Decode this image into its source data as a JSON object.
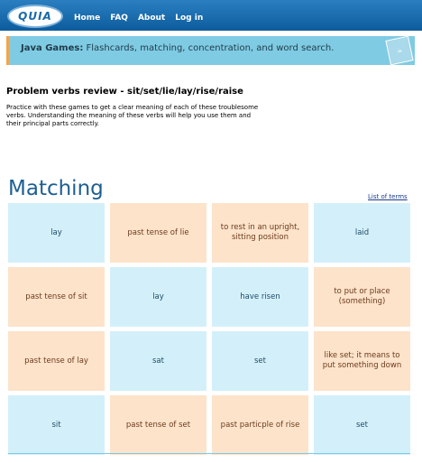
{
  "header": {
    "logo": "QUIA",
    "nav": [
      "Home",
      "FAQ",
      "About",
      "Log in"
    ]
  },
  "banner": {
    "bold": "Java Games:",
    "text": "Flashcards, matching, concentration, and word search.",
    "badge_icon": "java-badge-icon"
  },
  "page": {
    "title": "Problem verbs review - sit/set/lie/lay/rise/raise",
    "description": "Practice with these games to get a clear meaning of each of these troublesome verbs. Understanding the meaning of these verbs will help you use them and their principal parts correctly."
  },
  "matching": {
    "heading": "Matching",
    "list_link": "List of terms",
    "cards": [
      {
        "text": "lay",
        "kind": "term"
      },
      {
        "text": "past tense of lie",
        "kind": "def"
      },
      {
        "text": "to rest in an upright, sitting position",
        "kind": "def"
      },
      {
        "text": "laid",
        "kind": "term"
      },
      {
        "text": "past tense of sit",
        "kind": "def"
      },
      {
        "text": "lay",
        "kind": "term"
      },
      {
        "text": "have risen",
        "kind": "term"
      },
      {
        "text": "to put or place (something)",
        "kind": "def"
      },
      {
        "text": "past tense of lay",
        "kind": "def"
      },
      {
        "text": "sat",
        "kind": "term"
      },
      {
        "text": "set",
        "kind": "term"
      },
      {
        "text": "like set; it means to put something down",
        "kind": "def"
      },
      {
        "text": "sit",
        "kind": "term"
      },
      {
        "text": "past tense of set",
        "kind": "def"
      },
      {
        "text": "past particple of rise",
        "kind": "def"
      },
      {
        "text": "set",
        "kind": "term"
      }
    ]
  },
  "colors": {
    "term_bg": "#d3f0fa",
    "def_bg": "#fde3ca",
    "banner_bg": "#7fcbe3",
    "topbar": "#1a6aa8",
    "heading": "#1e5f92"
  }
}
